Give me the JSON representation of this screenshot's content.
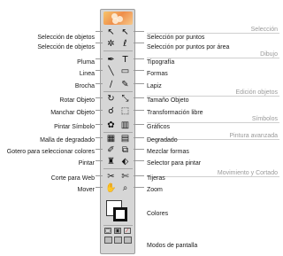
{
  "sections": {
    "seleccion": "Selección",
    "dibujo": "Dibujo",
    "edicion": "Edición objetos",
    "simbolos": "Símbolos",
    "pintura": "Pintura avanzada",
    "movimiento": "Movimiento y Cortado"
  },
  "left_labels": [
    "Selección de objetos",
    "Selección de objetos",
    "Pluma",
    "Linea",
    "Brocha",
    "Rotar Objeto",
    "Manchar Objeto",
    "Pintar Símbolo",
    "Malla de degradado",
    "Gotero para seleccionar colores",
    "Pintar",
    "Corte para Web",
    "Mover"
  ],
  "right_labels": [
    "Selección por puntos",
    "Selección por puntos por área",
    "Tipografía",
    "Formas",
    "Lapiz",
    "Tamaño Objeto",
    "Transformación libre",
    "Gráficos",
    "Degradado",
    "Mezclar formas",
    "Selector para pintar",
    "Tijeras",
    "Zoom"
  ],
  "bottom_labels": {
    "colores": "Colores",
    "modos": "Modos de pantalla"
  },
  "tool_icons": [
    [
      "selection-arrow-icon",
      "direct-selection-arrow-icon"
    ],
    [
      "magic-wand-icon",
      "lasso-icon"
    ],
    [
      "pen-icon",
      "type-icon"
    ],
    [
      "line-icon",
      "rectangle-icon"
    ],
    [
      "paintbrush-icon",
      "pencil-icon"
    ],
    [
      "rotate-icon",
      "scale-icon"
    ],
    [
      "warp-icon",
      "free-transform-icon"
    ],
    [
      "symbol-sprayer-icon",
      "column-graph-icon"
    ],
    [
      "mesh-icon",
      "gradient-icon"
    ],
    [
      "eyedropper-icon",
      "blend-icon"
    ],
    [
      "live-paint-bucket-icon",
      "live-paint-selection-icon"
    ],
    [
      "slice-icon",
      "scissors-icon"
    ],
    [
      "hand-icon",
      "zoom-icon"
    ]
  ],
  "tool_glyphs": [
    [
      "↖",
      "↖"
    ],
    [
      "✲",
      "ℓ"
    ],
    [
      "✒",
      "T"
    ],
    [
      "╲",
      "▭"
    ],
    [
      "∕",
      "✎"
    ],
    [
      "↻",
      "⤡"
    ],
    [
      "☌",
      "⬚"
    ],
    [
      "✿",
      "▥"
    ],
    [
      "▦",
      "▤"
    ],
    [
      "✐",
      "⧉"
    ],
    [
      "♜",
      "⬖"
    ],
    [
      "✂",
      "✄"
    ],
    [
      "✋",
      "⌕"
    ]
  ],
  "mode_glyphs": [
    "▢",
    "▣",
    "∕"
  ]
}
